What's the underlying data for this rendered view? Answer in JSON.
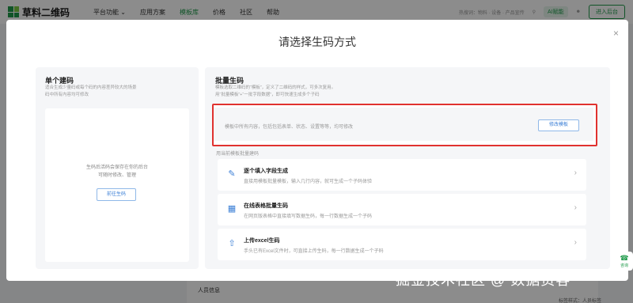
{
  "topbar": {
    "logo_text": "草料二维码",
    "nav": [
      "平台功能 ⌄",
      "应用方案",
      "模板库",
      "价格",
      "社区",
      "帮助"
    ],
    "right_text": "热搜词：物料 · 设备 · 产品宣传",
    "ai_badge": "AI赋能",
    "enter_label": "进入后台"
  },
  "background": {
    "section_label": "人员信息",
    "right_text": "标签样式：人员标签"
  },
  "modal": {
    "title": "请选择生码方式",
    "close": "×",
    "single": {
      "title": "单个建码",
      "desc": "适合生成少量码或每个码的内容差异较大的场景\n码中所有内容均可修改",
      "card_text": "生码后活码会保存在你的后台\n可随时修改、管理",
      "button": "前往生码"
    },
    "batch": {
      "title": "批量生码",
      "desc": "模板选取二维码的“模板”，定义了二维码的样式，可多次复用。\n用“批量模板”+“一批字段数据”，即可快速生成多个子码",
      "template_text": "模板中所有内容，包括包括表单、状态、设置等等，均可修改",
      "modify_button": "修改模板",
      "sub_label": "用当前模板批量建码",
      "options": [
        {
          "icon": "edit-icon",
          "title": "逐个填入字段生成",
          "desc": "直接用模板批量模板，输入几行内容，就可生成一个子码体验"
        },
        {
          "icon": "table-icon",
          "title": "在线表格批量生码",
          "desc": "在网页版表格中直接填写数据生码，每一行数据生成一个子码"
        },
        {
          "icon": "upload-icon",
          "title": "上传excel生码",
          "desc": "手头已有Excel文件时，可直接上传生码，每一行数据生成一个子码"
        }
      ]
    }
  },
  "service_badge": "咨询",
  "watermark": "掘金技术社区 @ 数据资客"
}
